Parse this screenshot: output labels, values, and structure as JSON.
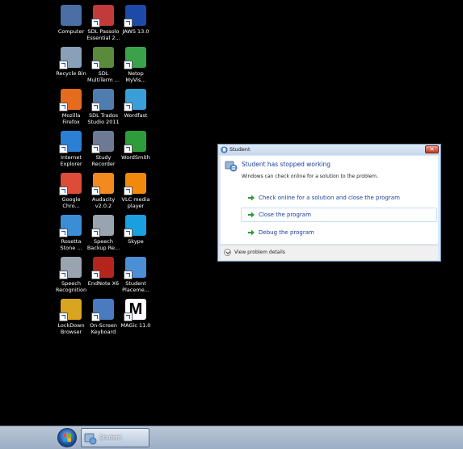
{
  "desktop": {
    "icons": [
      {
        "label": "Computer",
        "icon": "computer-icon",
        "color": "#4a6fa5"
      },
      {
        "label": "SDL Passolo Essential 2...",
        "icon": "sdl-passolo-icon",
        "color": "#c23b3b"
      },
      {
        "label": "JAWS 13.0",
        "icon": "jaws-icon",
        "color": "#1d4aa8"
      },
      {
        "label": "Recycle Bin",
        "icon": "recycle-bin-icon",
        "color": "#8aa0b8"
      },
      {
        "label": "SDL MultiTerm ...",
        "icon": "sdl-multiterm-icon",
        "color": "#5a8a3a"
      },
      {
        "label": "Netop MyVis...",
        "icon": "netop-icon",
        "color": "#3aa34a"
      },
      {
        "label": "Mozilla Firefox",
        "icon": "firefox-icon",
        "color": "#e56b1f"
      },
      {
        "label": "SDL Trados Studio 2011",
        "icon": "sdl-trados-icon",
        "color": "#4f7db0"
      },
      {
        "label": "Wordfast",
        "icon": "wordfast-icon",
        "color": "#3a9fd8"
      },
      {
        "label": "Internet Explorer",
        "icon": "internet-explorer-icon",
        "color": "#2b7fd4"
      },
      {
        "label": "Study Recorder",
        "icon": "study-recorder-icon",
        "color": "#6c7a93"
      },
      {
        "label": "WordSmith",
        "icon": "wordsmith-icon",
        "color": "#2e9c3a"
      },
      {
        "label": "Google Chro...",
        "icon": "chrome-icon",
        "color": "#dd4b39"
      },
      {
        "label": "Audacity v2.0.2",
        "icon": "audacity-icon",
        "color": "#f28a1f"
      },
      {
        "label": "VLC media player",
        "icon": "vlc-icon",
        "color": "#f18a0c"
      },
      {
        "label": "Rosetta Stone ...",
        "icon": "rosetta-stone-icon",
        "color": "#3b8ed6"
      },
      {
        "label": "Speech Backup Re...",
        "icon": "microphone-icon",
        "color": "#9aa4b0"
      },
      {
        "label": "Skype",
        "icon": "skype-icon",
        "color": "#1a9fe0"
      },
      {
        "label": "Speech Recognition",
        "icon": "microphone-icon",
        "color": "#9aa4b0"
      },
      {
        "label": "EndNote X6",
        "icon": "endnote-icon",
        "color": "#b3241c"
      },
      {
        "label": "Student Placeme...",
        "icon": "student-placement-icon",
        "color": "#4d8fd6"
      },
      {
        "label": "LockDown Browser",
        "icon": "lockdown-browser-icon",
        "color": "#d9a520"
      },
      {
        "label": "On-Screen Keyboard",
        "icon": "keyboard-icon",
        "color": "#4a7bc0"
      },
      {
        "label": "MAGic 11.0",
        "icon": "magic-icon",
        "color": "#ffffff"
      }
    ]
  },
  "dialog": {
    "title": "Student",
    "main_instruction": "Student has stopped working",
    "sub_text": "Windows can check online for a solution to the problem.",
    "options": [
      {
        "label": "Check online for a solution and close the program"
      },
      {
        "label": "Close the program"
      },
      {
        "label": "Debug the program"
      }
    ],
    "footer_label": "View problem details",
    "close_glyph": "✕"
  },
  "taskbar": {
    "task_label": "Student"
  },
  "colors": {
    "desktop_bg": "#000000",
    "link_blue": "#1d3f9c",
    "command_arrow": "#2e9a3a"
  }
}
